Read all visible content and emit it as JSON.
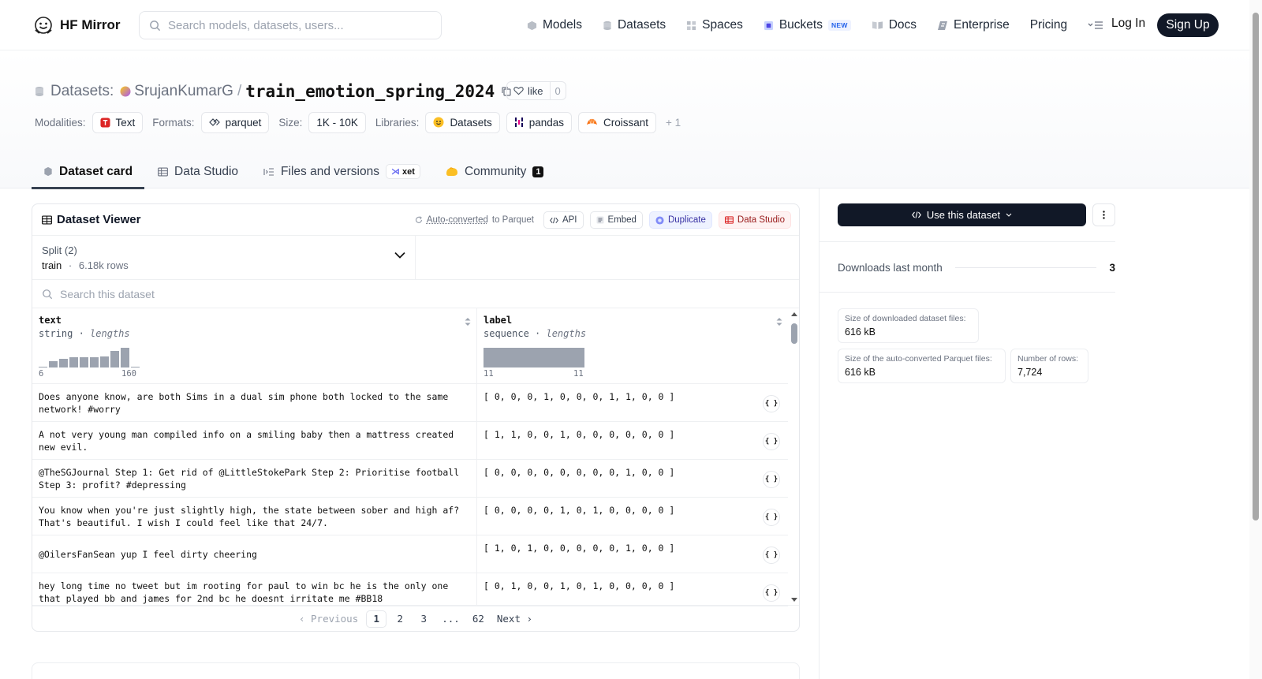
{
  "nav": {
    "brand": "HF Mirror",
    "search_placeholder": "Search models, datasets, users...",
    "items": [
      {
        "label": "Models",
        "icon": "models-icon"
      },
      {
        "label": "Datasets",
        "icon": "datasets-icon"
      },
      {
        "label": "Spaces",
        "icon": "spaces-icon"
      },
      {
        "label": "Buckets",
        "icon": "buckets-icon",
        "badge": "NEW"
      },
      {
        "label": "Docs",
        "icon": "docs-icon"
      },
      {
        "label": "Enterprise",
        "icon": "enterprise-icon"
      },
      {
        "label": "Pricing"
      }
    ],
    "login": "Log In",
    "signup": "Sign Up"
  },
  "header": {
    "section": "Datasets:",
    "owner": "SrujanKumarG",
    "separator": "/",
    "name": "train_emotion_spring_2024",
    "like_label": "like",
    "like_count": "0",
    "modalities_label": "Modalities:",
    "modality": "Text",
    "formats_label": "Formats:",
    "format": "parquet",
    "size_label": "Size:",
    "size": "1K - 10K",
    "libraries_label": "Libraries:",
    "libraries": [
      "Datasets",
      "pandas",
      "Croissant"
    ],
    "libraries_more": "+ 1"
  },
  "tabs": {
    "card": "Dataset card",
    "studio": "Data Studio",
    "files": "Files and versions",
    "xet": "xet",
    "community": "Community",
    "community_count": "1"
  },
  "viewer": {
    "title": "Dataset Viewer",
    "autoconv_link": "Auto-converted",
    "autoconv_rest": "to Parquet",
    "api": "API",
    "embed": "Embed",
    "duplicate": "Duplicate",
    "studio": "Data Studio",
    "split_label": "Split (2)",
    "split_value": "train",
    "split_sep": "·",
    "split_rows": "6.18k rows",
    "search_placeholder": "Search this dataset",
    "columns": [
      {
        "name": "text",
        "type": "string",
        "stat": "lengths",
        "min": "6",
        "max": "160",
        "hist": [
          0.05,
          0.3,
          0.45,
          0.5,
          0.5,
          0.52,
          0.55,
          0.82,
          1.0,
          0.05
        ]
      },
      {
        "name": "label",
        "type": "sequence",
        "stat": "lengths",
        "min": "11",
        "max": "11"
      }
    ],
    "rows": [
      {
        "text": "Does anyone know, are both Sims in a dual sim phone both locked to the same network! #worry",
        "label": "[ 0, 0, 0, 1, 0, 0, 0, 1, 1, 0, 0 ]"
      },
      {
        "text": "A not very young man compiled info on a smiling baby then a mattress created new evil.",
        "label": "[ 1, 1, 0, 0, 1, 0, 0, 0, 0, 0, 0 ]"
      },
      {
        "text": "@TheSGJournal Step 1: Get rid of @LittleStokePark Step 2: Prioritise football Step 3: profit? #depressing",
        "label": "[ 0, 0, 0, 0, 0, 0, 0, 0, 1, 0, 0 ]"
      },
      {
        "text": "You know when you're just slightly high, the state between sober and high af? That's beautiful. I wish I could feel like that 24/7.",
        "label": "[ 0, 0, 0, 0, 1, 0, 1, 0, 0, 0, 0 ]"
      },
      {
        "text": "@OilersFanSean yup I feel dirty cheering",
        "label": "[ 1, 0, 1, 0, 0, 0, 0, 0, 1, 0, 0 ]"
      },
      {
        "text": "hey long time no tweet but im rooting for paul to win bc he is the only one that played bb and james for 2nd bc he doesnt irritate me #BB18",
        "label": "[ 0, 1, 0, 0, 1, 0, 1, 0, 0, 0, 0 ]"
      }
    ],
    "json_label": "{ }",
    "pager": {
      "prev": "Previous",
      "pages": [
        "1",
        "2",
        "3",
        "...",
        "62"
      ],
      "next": "Next"
    }
  },
  "sidebar": {
    "use_button": "Use this dataset",
    "downloads_label": "Downloads last month",
    "downloads_value": "3",
    "stats": [
      {
        "k": "Size of downloaded dataset files:",
        "v": "616 kB"
      },
      {
        "k": "Size of the auto-converted Parquet files:",
        "v": "616 kB"
      },
      {
        "k": "Number of rows:",
        "v": "7,724"
      }
    ]
  }
}
